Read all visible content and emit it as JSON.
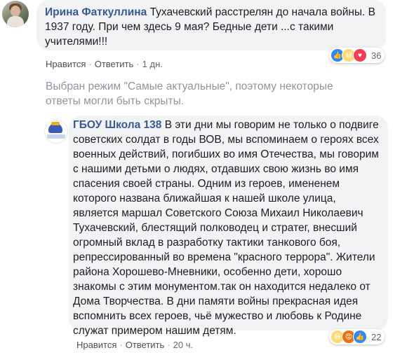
{
  "comment1": {
    "author": "Ирина Фаткуллина",
    "text": "Тухачевский расстрелян до начала войны. В 1937 году. При чем здесь 9 мая? Бедные дети ...с такими учителями!!!",
    "reactions": {
      "icons": [
        "like-icon",
        "haha-icon",
        "love-icon"
      ],
      "count": "36"
    },
    "actions": {
      "like": "Нравится",
      "reply": "Ответить",
      "time": "1 дн."
    }
  },
  "notice": "Выбран режим \"Самые актуальные\", поэтому некоторые ответы могли быть скрыты.",
  "comment2": {
    "author": "ГБОУ Школа 138",
    "text": "В эти дни мы говорим не только о подвиге советских солдат в годы ВОВ, мы вспоминаем о героях всех военных действий, погибших во имя Отечества, мы говорим с нашими детьми о людях, отдавших свою жизнь во имя спасения своей страны. Одним из героев, имененем которого названа ближайшая к нашей школе улица, является маршал Советского Союза Михаил Николаевич Тухачевский, блестящий полководец и стратег, внесший огромный вклад в разработку тактики танкового боя, репрессированный во времена \"красного террора\". Жители района Хорошево-Мневники, особенно дети, хорошо знакомы с этим монументом.так он находится недалеко от Дома Творчества. В дни памяти войны прекрасная идея вспомнить всех героев, чьё мужество и любовь к Родине служат примером нашим детям.",
    "reactions": {
      "icons": [
        "haha-icon",
        "angry-icon",
        "like-icon"
      ],
      "count": "22"
    },
    "actions": {
      "like": "Нравится",
      "reply": "Ответить",
      "time": "20 ч."
    }
  },
  "colors": {
    "name": "#385898",
    "bubble": "#f2f3f5",
    "meta": "#90949c",
    "action": "#4b4f56"
  }
}
